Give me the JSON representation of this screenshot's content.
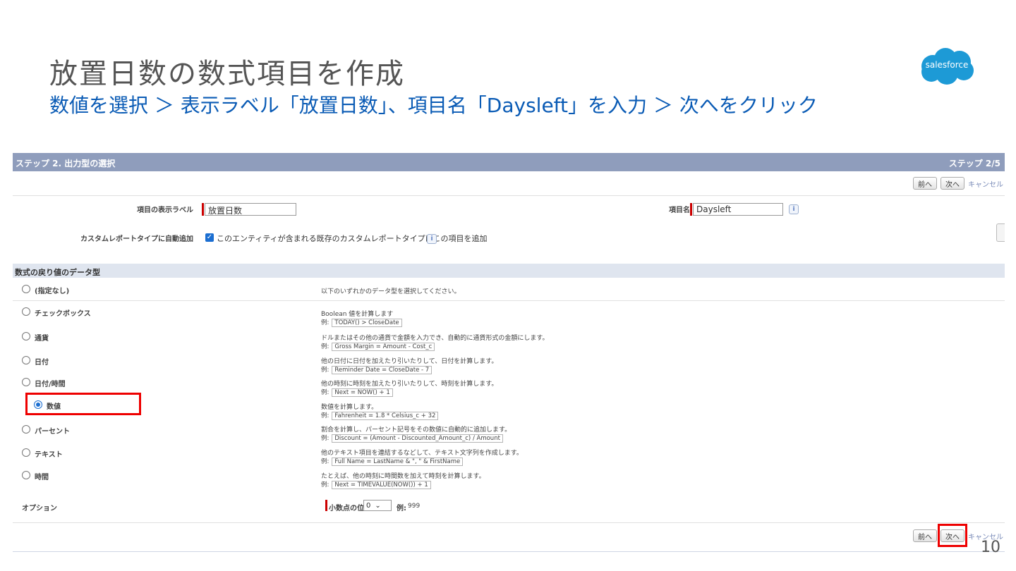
{
  "slide": {
    "title": "放置日数の数式項目を作成",
    "subtitle": "数値を選択 ＞ 表示ラベル「放置日数」、項目名「Daysleft」を入力 ＞ 次へをクリック",
    "logo_text": "salesforce",
    "page_number": "10"
  },
  "colors": {
    "header": "#8f9dbc",
    "section": "#dfe5ef",
    "accent": "#1b6ed1",
    "highlight": "#ee0000",
    "subtitle": "#0a5bb5"
  },
  "wizard": {
    "step_title": "ステップ 2. 出力型の選択",
    "step_count": "ステップ 2/5",
    "prev_label": "前へ",
    "next_label": "次へ",
    "cancel_label": "キャンセル",
    "field_label_caption": "項目の表示ラベル",
    "field_label_value": "放置日数",
    "field_name_caption": "項目名",
    "field_name_value": "Daysleft",
    "info_glyph": "i",
    "auto_add_caption": "カスタムレポートタイプに自動追加",
    "auto_add_text": "このエンティティが含まれる既存のカスタムレポートタイプにこの項目を追加",
    "section_title": "数式の戻り値のデータ型",
    "none_option": "(指定なし)",
    "none_desc": "以下のいずれかのデータ型を選択してください。",
    "example_prefix": "例:",
    "options": [
      {
        "label": "チェックボックス",
        "desc": "Boolean 値を計算します",
        "example": "TODAY() > CloseDate"
      },
      {
        "label": "通貨",
        "desc": "ドルまたはその他の通貨で金額を入力でき、自動的に通貨形式の金額にします。",
        "example": "Gross Margin = Amount - Cost_c"
      },
      {
        "label": "日付",
        "desc": "他の日付に日付を加えたり引いたりして、日付を計算します。",
        "example": "Reminder Date = CloseDate - 7"
      },
      {
        "label": "日付/時間",
        "desc": "他の時刻に時刻を加えたり引いたりして、時刻を計算します。",
        "example": "Next = NOW() + 1"
      },
      {
        "label": "数値",
        "desc": "数値を計算します。",
        "example": "Fahrenheit = 1.8 * Celsius_c + 32"
      },
      {
        "label": "パーセント",
        "desc": "割合を計算し、パーセント記号をその数値に自動的に追加します。",
        "example": "Discount = (Amount - Discounted_Amount_c) / Amount"
      },
      {
        "label": "テキスト",
        "desc": "他のテキスト項目を連結するなどして、テキスト文字列を作成します。",
        "example": "Full Name = LastName & \", \" & FirstName"
      },
      {
        "label": "時間",
        "desc": "たとえば、他の時刻に時間数を加えて時刻を計算します。",
        "example": "Next = TIMEVALUE(NOW()) + 1"
      }
    ],
    "selected_option": "数値",
    "options_caption": "オプション",
    "decimal_caption": "小数点の位置",
    "decimal_value": "0",
    "decimal_example_label": "例:",
    "decimal_example_value": "999"
  }
}
